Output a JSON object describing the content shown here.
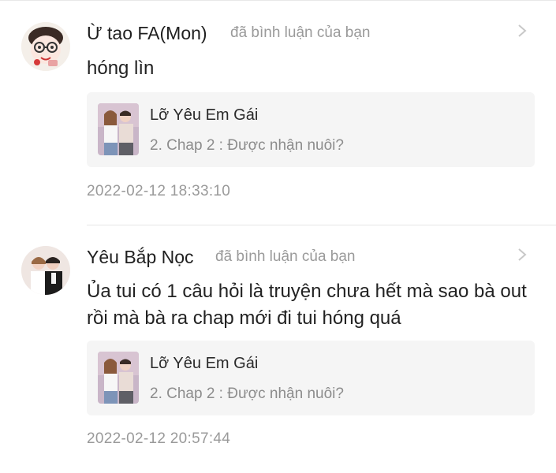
{
  "notifications": [
    {
      "user": "Ừ tao FA(Mon)",
      "action": "đã bình luận của bạn",
      "comment": "hóng lìn",
      "card": {
        "title": "Lỡ Yêu Em Gái",
        "subtitle": "2. Chap 2 : Được nhận nuôi?"
      },
      "timestamp": "2022-02-12 18:33:10",
      "avatar_icon": "cartoon-avatar-icon"
    },
    {
      "user": "Yêu Bắp Nọc",
      "action": "đã bình luận của bạn",
      "comment": "Ủa tui có 1 câu hỏi là truyện chưa hết mà sao bà out rồi mà bà ra chap mới đi tui hóng quá",
      "card": {
        "title": "Lỡ Yêu Em Gái",
        "subtitle": "2. Chap 2 : Được nhận nuôi?"
      },
      "timestamp": "2022-02-12 20:57:44",
      "avatar_icon": "couple-avatar-icon"
    }
  ],
  "colors": {
    "muted": "#9a9a9a",
    "card_bg": "#f5f5f5",
    "text": "#222222"
  }
}
